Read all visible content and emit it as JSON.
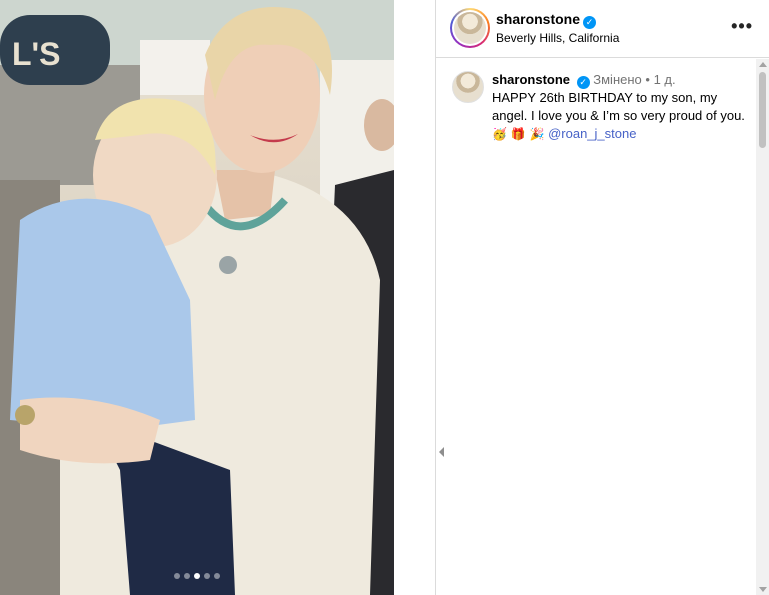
{
  "post": {
    "username": "sharonstone",
    "location": "Beverly Hills, California",
    "more_label": "•••",
    "verified_glyph": "✓"
  },
  "carousel": {
    "slide_count": 5,
    "active_index": 2
  },
  "photo_sign_text": "L'S",
  "comment": {
    "username": "sharonstone",
    "edited": "Змінено",
    "separator": "•",
    "time": "1 д.",
    "text_line": "HAPPY 26th BIRTHDAY to my son, my angel.  I love you & I’m so very proud of you.",
    "emojis": "🥳 🎁 🎉",
    "mention": "@roan_j_stone"
  },
  "colors": {
    "verified": "#0095f6",
    "mention": "#4762c7",
    "muted": "#737373"
  },
  "icons": [
    "verified-badge-icon",
    "more-options-icon",
    "scroll-up-icon",
    "scroll-down-icon",
    "collapse-arrow-icon"
  ]
}
